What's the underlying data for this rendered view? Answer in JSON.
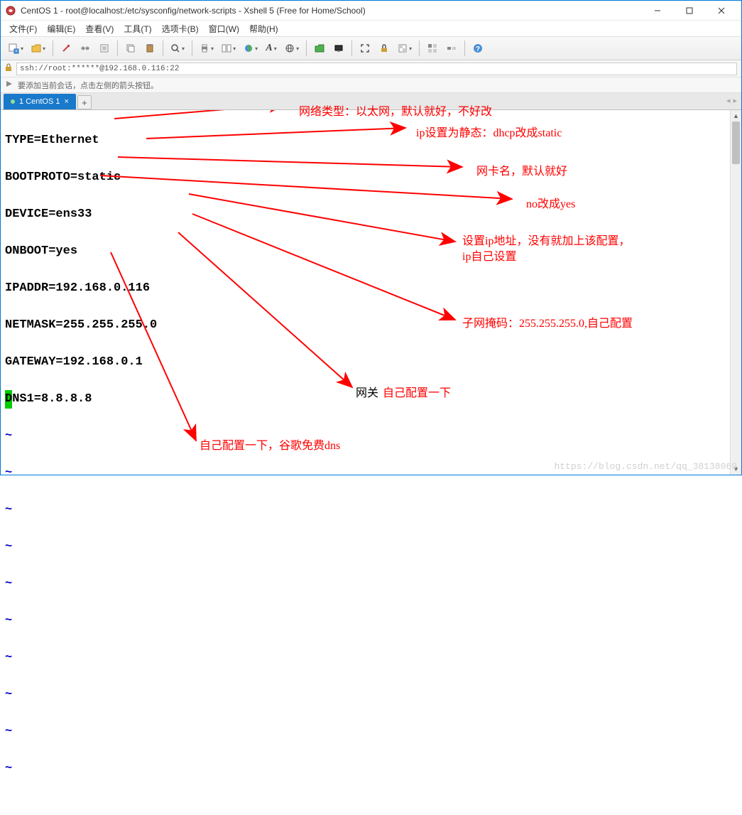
{
  "title": "CentOS 1 - root@localhost:/etc/sysconfig/network-scripts - Xshell 5 (Free for Home/School)",
  "menu": {
    "file": "文件(F)",
    "edit": "编辑(E)",
    "view": "查看(V)",
    "tools": "工具(T)",
    "tabs": "选项卡(B)",
    "window": "窗口(W)",
    "help": "帮助(H)"
  },
  "address": "ssh://root:******@192.168.0.116:22",
  "hint": "要添加当前会话，点击左侧的箭头按钮。",
  "tab": {
    "label": "1 CentOS 1",
    "close": "×",
    "add": "+"
  },
  "terminal": {
    "lines": [
      "TYPE=Ethernet",
      "BOOTPROTO=static",
      "DEVICE=ens33",
      "ONBOOT=yes",
      "IPADDR=192.168.0.116",
      "NETMASK=255.255.255.0",
      "GATEWAY=192.168.0.1",
      "DNS1=8.8.8.8"
    ],
    "cursor_char": "D",
    "tilde": "~"
  },
  "annotations": {
    "a1": "网络类型：以太网，默认就好，不好改",
    "a2": "ip设置为静态：dhcp改成static",
    "a3": "网卡名，默认就好",
    "a4": "no改成yes",
    "a5": "设置ip地址，没有就加上该配置，",
    "a5b": "ip自己设置",
    "a6": "子网掩码：255.255.255.0,自己配置",
    "a7a": "网关",
    "a7b": "自己配置一下",
    "a8": "自己配置一下，谷歌免费dns"
  },
  "watermark": "https://blog.csdn.net/qq_38138069"
}
